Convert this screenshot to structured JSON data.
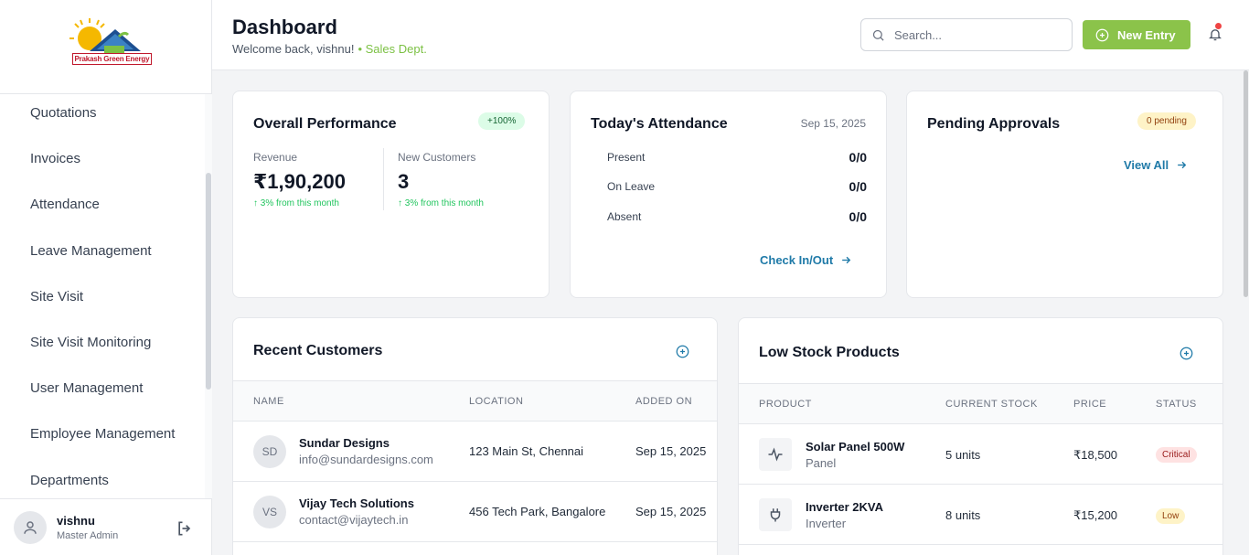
{
  "brand": {
    "logo_text": "Prakash Green Energy"
  },
  "sidebar": {
    "items": [
      {
        "label": "Quotations"
      },
      {
        "label": "Invoices"
      },
      {
        "label": "Attendance"
      },
      {
        "label": "Leave Management"
      },
      {
        "label": "Site Visit"
      },
      {
        "label": "Site Visit Monitoring"
      },
      {
        "label": "User Management"
      },
      {
        "label": "Employee Management"
      },
      {
        "label": "Departments"
      }
    ],
    "user": {
      "name": "vishnu",
      "role": "Master Admin"
    }
  },
  "header": {
    "title": "Dashboard",
    "welcome": "Welcome back, vishnu!",
    "dept": "• Sales Dept.",
    "search_placeholder": "Search...",
    "new_entry_label": "New Entry"
  },
  "performance": {
    "title": "Overall Performance",
    "badge": "+100%",
    "revenue_label": "Revenue",
    "revenue_value": "₹1,90,200",
    "revenue_delta": "3% from this month",
    "customers_label": "New Customers",
    "customers_value": "3",
    "customers_delta": "3% from this month"
  },
  "attendance": {
    "title": "Today's Attendance",
    "date": "Sep 15, 2025",
    "rows": [
      {
        "label": "Present",
        "value": "0/0"
      },
      {
        "label": "On Leave",
        "value": "0/0"
      },
      {
        "label": "Absent",
        "value": "0/0"
      }
    ],
    "link": "Check In/Out"
  },
  "approvals": {
    "title": "Pending Approvals",
    "badge": "0 pending",
    "link": "View All"
  },
  "customers": {
    "title": "Recent Customers",
    "columns": [
      "NAME",
      "LOCATION",
      "ADDED ON"
    ],
    "rows": [
      {
        "initials": "SD",
        "name": "Sundar Designs",
        "email": "info@sundardesigns.com",
        "location": "123 Main St, Chennai",
        "added": "Sep 15, 2025"
      },
      {
        "initials": "VS",
        "name": "Vijay Tech Solutions",
        "email": "contact@vijaytech.in",
        "location": "456 Tech Park, Bangalore",
        "added": "Sep 15, 2025"
      }
    ]
  },
  "products": {
    "title": "Low Stock Products",
    "columns": [
      "PRODUCT",
      "CURRENT STOCK",
      "PRICE",
      "STATUS"
    ],
    "rows": [
      {
        "icon": "activity-icon",
        "name": "Solar Panel 500W",
        "category": "Panel",
        "stock": "5 units",
        "price": "₹18,500",
        "status": "Critical",
        "status_color": "#fee2e2",
        "status_text_color": "#991b1b"
      },
      {
        "icon": "plug-icon",
        "name": "Inverter 2KVA",
        "category": "Inverter",
        "stock": "8 units",
        "price": "₹15,200",
        "status": "Low",
        "status_color": "#fef3c7",
        "status_text_color": "#92400e"
      }
    ]
  },
  "colors": {
    "accent_green": "#8bc34a",
    "link_blue": "#1f7aa8"
  }
}
